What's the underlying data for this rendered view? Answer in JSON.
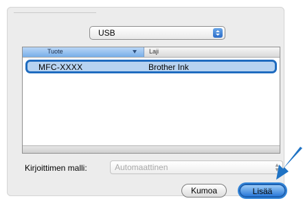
{
  "connection_popup": {
    "value": "USB"
  },
  "table": {
    "columns": [
      "Tuote",
      "Laji"
    ],
    "rows": [
      {
        "name": "MFC-XXXX",
        "kind": "Brother Ink"
      }
    ]
  },
  "printer_model": {
    "label": "Kirjoittimen malli:",
    "value": "Automaattinen"
  },
  "buttons": {
    "cancel": "Kumoa",
    "add": "Lisää"
  },
  "colors": {
    "selection": "#b7d3f1",
    "highlight_border": "#1e6bbf",
    "pointer_arrow": "#1f73c4"
  }
}
